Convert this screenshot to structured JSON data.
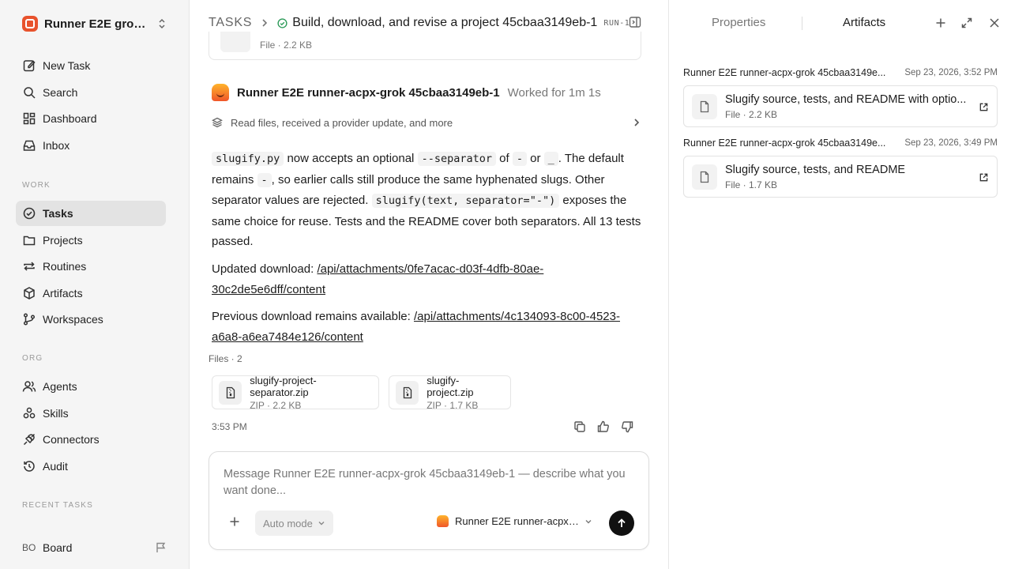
{
  "workspace": {
    "name": "Runner E2E grok-..."
  },
  "nav_main": [
    {
      "label": "New Task",
      "icon": "edit-icon"
    },
    {
      "label": "Search",
      "icon": "search-icon"
    },
    {
      "label": "Dashboard",
      "icon": "dashboard-icon"
    },
    {
      "label": "Inbox",
      "icon": "inbox-icon"
    }
  ],
  "sections": {
    "work": "WORK",
    "org": "ORG",
    "recent": "RECENT TASKS"
  },
  "nav_work": [
    {
      "label": "Tasks",
      "icon": "check-circle-icon",
      "active": true
    },
    {
      "label": "Projects",
      "icon": "folder-icon"
    },
    {
      "label": "Routines",
      "icon": "repeat-icon"
    },
    {
      "label": "Artifacts",
      "icon": "box-icon"
    },
    {
      "label": "Workspaces",
      "icon": "git-branch-icon"
    }
  ],
  "nav_org": [
    {
      "label": "Agents",
      "icon": "users-icon"
    },
    {
      "label": "Skills",
      "icon": "skills-icon"
    },
    {
      "label": "Connectors",
      "icon": "plug-icon"
    },
    {
      "label": "Audit",
      "icon": "history-icon"
    }
  ],
  "board": {
    "badge": "BO",
    "label": "Board"
  },
  "header": {
    "root": "TASKS",
    "title": "Build, download, and revise a project 45cbaa3149eb-1",
    "run": "RUN-1",
    "status_color": "#2e9b5a"
  },
  "prev_card": {
    "meta": "File · 2.2 KB"
  },
  "agent": {
    "name": "Runner E2E runner-acpx-grok 45cbaa3149eb-1",
    "worked": "Worked for 1m 1s"
  },
  "activity": {
    "text": "Read files, received a provider update, and more"
  },
  "message": {
    "p1": {
      "c1": "slugify.py",
      "t1": " now accepts an optional ",
      "c2": "--separator",
      "t2": " of ",
      "c3": "-",
      "t3": " or ",
      "c4": "_",
      "t4": ". The default remains ",
      "c5": "-",
      "t5": ", so earlier calls still produce the same hyphenated slugs. Other separator values are rejected. ",
      "c6": "slugify(text, separator=\"-\")",
      "t6": " exposes the same choice for reuse. Tests and the README cover both separators. All 13 tests passed."
    },
    "p2_label": "Updated download: ",
    "p2_link": "/api/attachments/0fe7acac-d03f-4dfb-80ae-30c2de5e6dff/content",
    "p3_label": "Previous download remains available: ",
    "p3_link": "/api/attachments/4c134093-8c00-4523-a6a8-a6ea7484e126/content"
  },
  "files": {
    "label": "Files · 2",
    "items": [
      {
        "name": "slugify-project-separator.zip",
        "meta": "ZIP · 2.2 KB"
      },
      {
        "name": "slugify-project.zip",
        "meta": "ZIP · 1.7 KB"
      }
    ]
  },
  "msg_time": "3:53 PM",
  "composer": {
    "placeholder": "Message Runner E2E runner-acpx-grok 45cbaa3149eb-1 — describe what you want done...",
    "mode": "Auto mode",
    "agent": "Runner E2E runner-acpx-..."
  },
  "right_panel": {
    "tab_properties": "Properties",
    "tab_artifacts": "Artifacts",
    "groups": [
      {
        "who": "Runner E2E runner-acpx-grok 45cbaa3149e...",
        "when": "Sep 23, 2026, 3:52 PM",
        "title": "Slugify source, tests, and README with optio...",
        "meta": "File · 2.2 KB"
      },
      {
        "who": "Runner E2E runner-acpx-grok 45cbaa3149e...",
        "when": "Sep 23, 2026, 3:49 PM",
        "title": "Slugify source, tests, and README",
        "meta": "File · 1.7 KB"
      }
    ]
  }
}
